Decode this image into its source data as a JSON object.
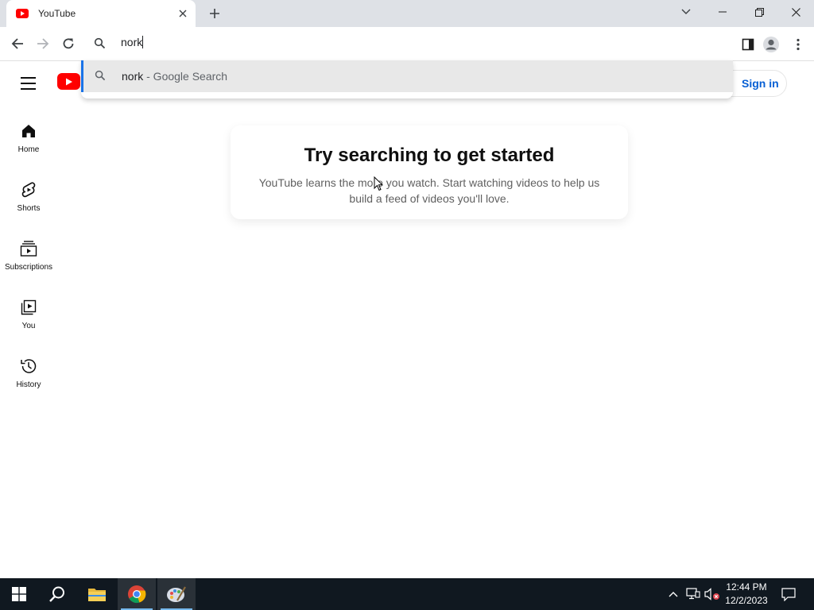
{
  "browser": {
    "tab": {
      "title": "YouTube",
      "favicon": "youtube-icon",
      "close_icon": "close-icon"
    },
    "new_tab_icon": "plus-icon",
    "window_controls": [
      "chevron-down-icon",
      "minimize-icon",
      "restore-icon",
      "close-icon"
    ],
    "nav": [
      "back-icon",
      "forward-icon",
      "reload-icon"
    ],
    "omnibox": {
      "value": "nork",
      "icon": "search-icon"
    },
    "suggestion": {
      "query": "nork",
      "suffix": " - Google Search",
      "icon": "search-icon"
    },
    "toolbar_right": [
      "side-panel-icon",
      "profile-icon",
      "kebab-menu-icon"
    ],
    "accent_color": "#1a73e8"
  },
  "youtube": {
    "logo_color": "#ff0000",
    "sign_in": "Sign in",
    "guide": [
      {
        "label": "Home",
        "icon": "home-icon"
      },
      {
        "label": "Shorts",
        "icon": "shorts-icon"
      },
      {
        "label": "Subscriptions",
        "icon": "subscriptions-icon"
      },
      {
        "label": "You",
        "icon": "you-icon"
      },
      {
        "label": "History",
        "icon": "history-icon"
      }
    ],
    "empty_state": {
      "title": "Try searching to get started",
      "body": "YouTube learns the more you watch. Start watching videos to help us build a feed of videos you'll love."
    }
  },
  "taskbar": {
    "apps": [
      "windows-start-icon",
      "search-icon",
      "file-explorer-icon",
      "chrome-icon",
      "paint-icon"
    ],
    "tray": [
      "chevron-up-icon",
      "network-icon",
      "volume-muted-icon"
    ],
    "time": "12:44 PM",
    "date": "12/2/2023"
  }
}
